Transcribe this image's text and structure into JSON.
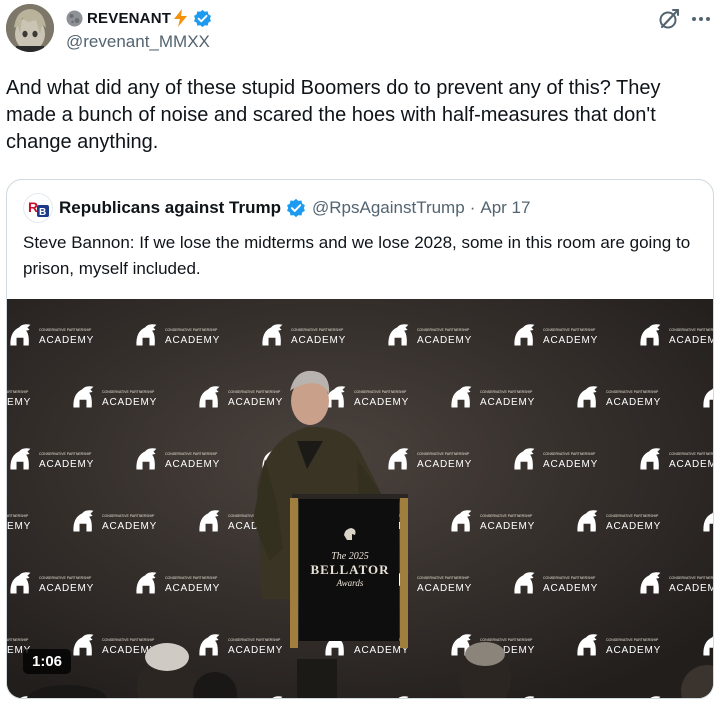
{
  "post": {
    "author": {
      "display_name": "REVENANT",
      "handle": "@revenant_MMXX",
      "verified": true,
      "name_emojis": [
        "moon-emoji",
        "lightning-emoji"
      ]
    },
    "text": "And what did any of these stupid Boomers do to prevent any of this? They made a bunch of noise and scared the hoes with half-measures that don't change anything.",
    "actions": {
      "grok_icon": "grok-icon",
      "more_icon": "more-icon"
    }
  },
  "quote": {
    "author": {
      "display_name": "Republicans against Trump",
      "handle": "@RpsAgainstTrump",
      "verified": true,
      "logo_letters": "RB"
    },
    "separator": "·",
    "date": "Apr 17",
    "text": "Steve Bannon: If we lose the midterms and we lose 2028, some in this room are going to prison, myself included.",
    "video": {
      "duration": "1:06",
      "backdrop_org": "CONSERVATIVE PARTNERSHIP",
      "backdrop_word": "ACADEMY",
      "podium_line1": "The 2025",
      "podium_line2": "BELLATOR",
      "podium_line3": "Awards"
    }
  },
  "colors": {
    "verified_blue": "#1d9bf0",
    "text_primary": "#0f1419",
    "text_secondary": "#536471",
    "border": "#cfd9de",
    "backdrop": "#3a3431"
  }
}
